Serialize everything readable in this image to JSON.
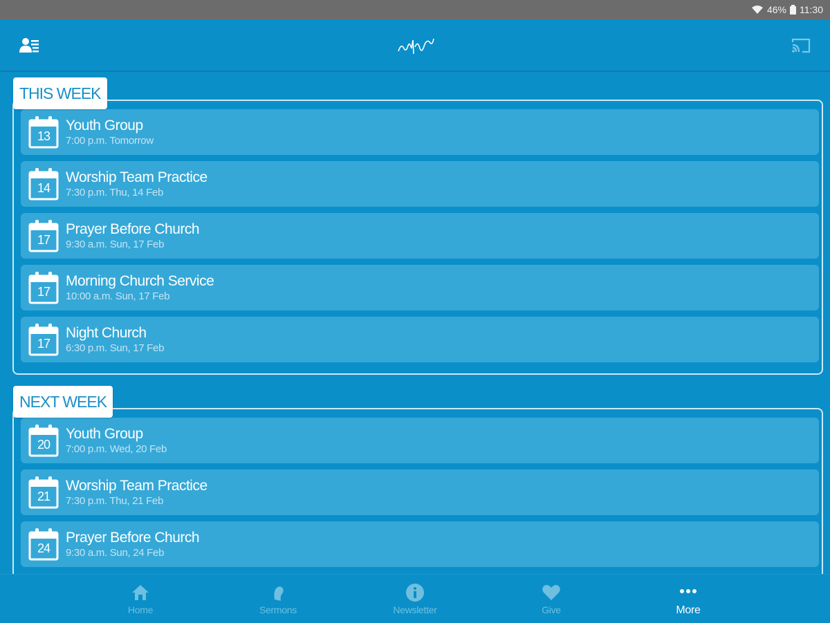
{
  "status_bar": {
    "battery": "46%",
    "time": "11:30"
  },
  "sections": [
    {
      "label": "THIS WEEK",
      "events": [
        {
          "day": "13",
          "title": "Youth Group",
          "subtitle": "7:00 p.m. Tomorrow"
        },
        {
          "day": "14",
          "title": "Worship Team Practice",
          "subtitle": "7:30 p.m. Thu, 14 Feb"
        },
        {
          "day": "17",
          "title": "Prayer Before Church",
          "subtitle": "9:30 a.m. Sun, 17 Feb"
        },
        {
          "day": "17",
          "title": "Morning Church Service",
          "subtitle": "10:00 a.m. Sun, 17 Feb"
        },
        {
          "day": "17",
          "title": "Night Church",
          "subtitle": "6:30 p.m. Sun, 17 Feb"
        }
      ]
    },
    {
      "label": "NEXT WEEK",
      "events": [
        {
          "day": "20",
          "title": "Youth Group",
          "subtitle": "7:00 p.m. Wed, 20 Feb"
        },
        {
          "day": "21",
          "title": "Worship Team Practice",
          "subtitle": "7:30 p.m. Thu, 21 Feb"
        },
        {
          "day": "24",
          "title": "Prayer Before Church",
          "subtitle": "9:30 a.m. Sun, 24 Feb"
        }
      ]
    }
  ],
  "bottom_nav": [
    {
      "label": "Home",
      "icon": "home-icon",
      "active": false
    },
    {
      "label": "Sermons",
      "icon": "sermons-icon",
      "active": false
    },
    {
      "label": "Newsletter",
      "icon": "info-icon",
      "active": false
    },
    {
      "label": "Give",
      "icon": "heart-icon",
      "active": false
    },
    {
      "label": "More",
      "icon": "more-icon",
      "active": true
    }
  ],
  "colors": {
    "background": "#0a8fc9",
    "card": "#35a8d8",
    "status_bar": "#6c6c6c",
    "label_text": "#1a8fc8",
    "nav_inactive": "#6fbfe0"
  }
}
